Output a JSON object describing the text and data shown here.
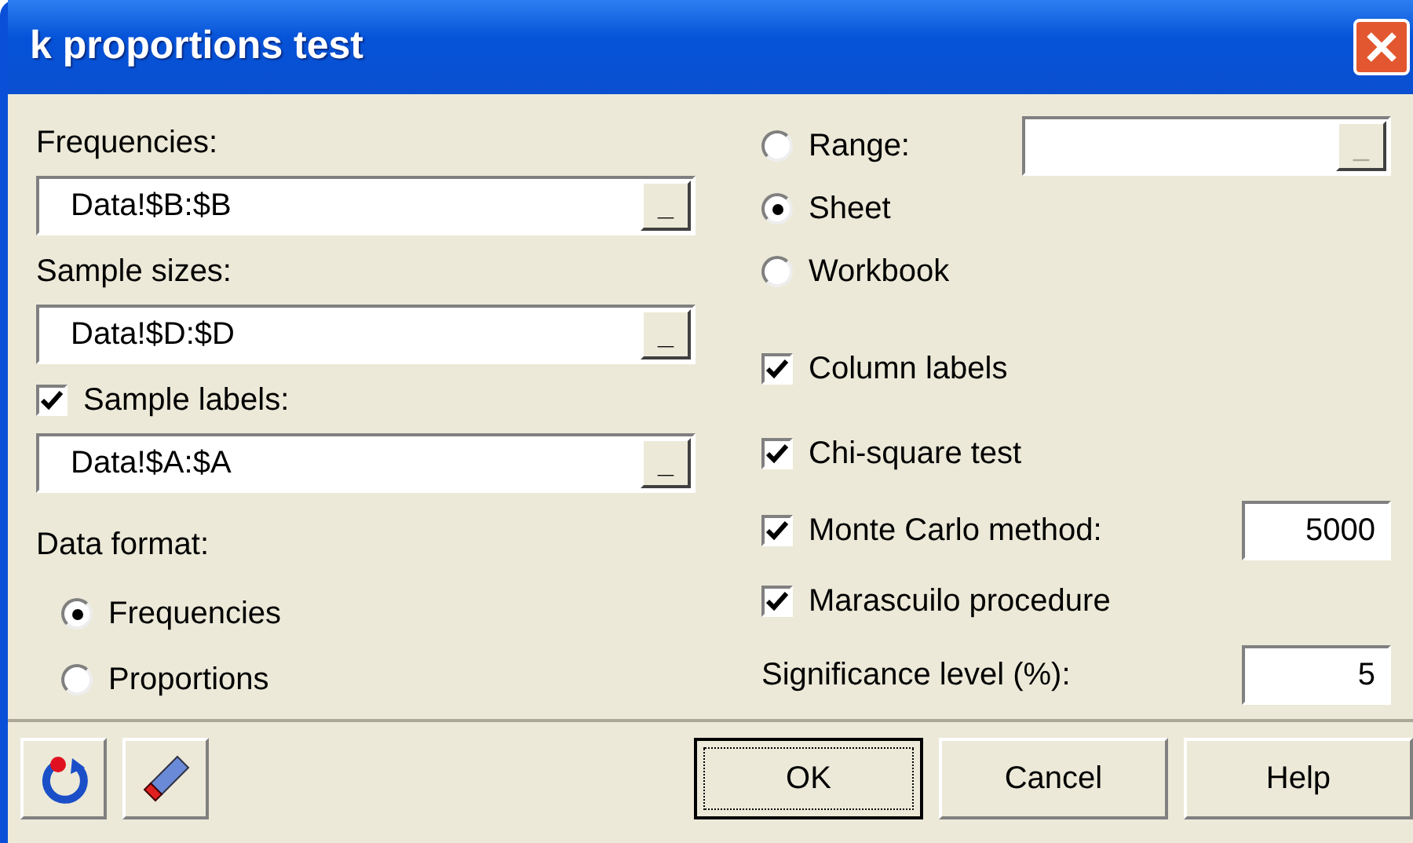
{
  "window": {
    "title": "k proportions test"
  },
  "left": [
    {
      "kind": "label",
      "text": "Frequencies:"
    },
    {
      "kind": "field",
      "value": "Data!$B:$B",
      "button": "_"
    },
    {
      "kind": "label",
      "text": "Sample sizes:"
    },
    {
      "kind": "field",
      "value": "Data!$D:$D",
      "button": "_"
    },
    {
      "kind": "check",
      "label": "Sample labels:",
      "checked": true
    },
    {
      "kind": "field",
      "value": "Data!$A:$A",
      "button": "_"
    },
    {
      "kind": "label",
      "text": "Data format:"
    },
    {
      "kind": "radio",
      "label": "Frequencies",
      "selected": true
    },
    {
      "kind": "radio",
      "label": "Proportions",
      "selected": false
    }
  ],
  "right": [
    {
      "kind": "radio_field",
      "label": "Range:",
      "selected": false,
      "button": "_",
      "disabled": true
    },
    {
      "kind": "radio",
      "label": "Sheet",
      "selected": true
    },
    {
      "kind": "radio",
      "label": "Workbook",
      "selected": false
    },
    {
      "kind": "check",
      "label": "Column labels",
      "checked": true
    },
    {
      "kind": "check",
      "label": "Chi-square test",
      "checked": true
    },
    {
      "kind": "check_input",
      "label": "Monte Carlo method:",
      "checked": true,
      "value": "5000"
    },
    {
      "kind": "check",
      "label": "Marascuilo procedure",
      "checked": true
    },
    {
      "kind": "label_input",
      "label": "Significance level (%):",
      "value": "5"
    }
  ],
  "buttons": [
    {
      "label": "OK",
      "default": true
    },
    {
      "label": "Cancel",
      "default": false
    },
    {
      "label": "Help",
      "default": false
    }
  ]
}
